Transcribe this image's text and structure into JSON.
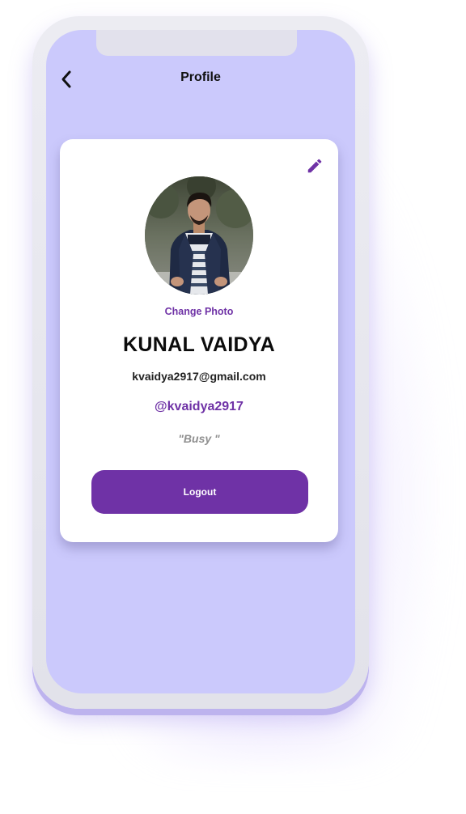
{
  "header": {
    "title": "Profile",
    "back_icon": "chevron-left-icon"
  },
  "profile": {
    "edit_icon": "pencil-icon",
    "change_photo_label": "Change Photo",
    "name": "KUNAL VAIDYA",
    "email": "kvaidya2917@gmail.com",
    "handle": "@kvaidya2917",
    "status": "\"Busy \""
  },
  "actions": {
    "logout_label": "Logout"
  },
  "colors": {
    "accent": "#6f32a6",
    "screen_background": "#cbc9fc",
    "card_background": "#ffffff"
  }
}
